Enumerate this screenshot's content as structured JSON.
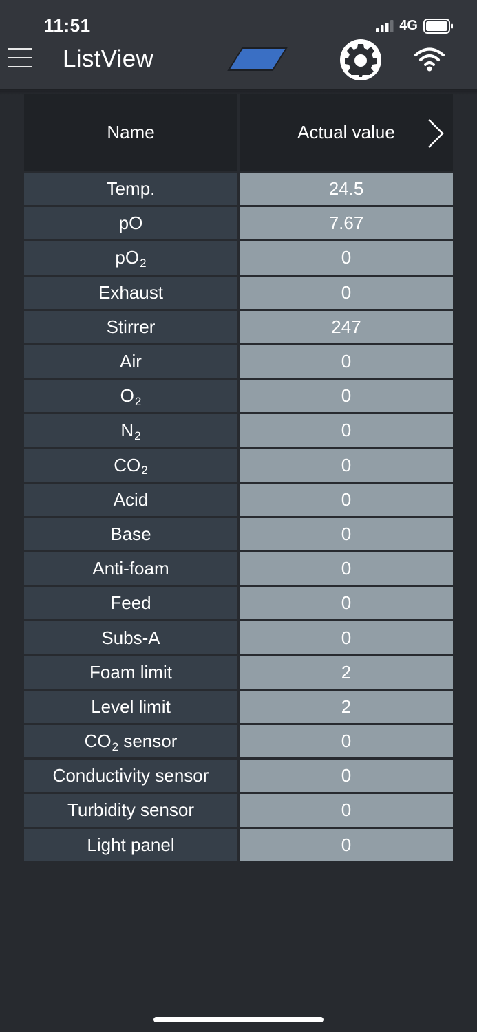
{
  "status_bar": {
    "time": "11:51",
    "network": "4G"
  },
  "app_bar": {
    "title": "ListView",
    "icons": [
      "menu-icon",
      "device-icon",
      "settings-icon",
      "wifi-icon"
    ],
    "device_icon_color": "#3a6fc4"
  },
  "table": {
    "header": {
      "name": "Name",
      "value": "Actual value"
    },
    "rows": [
      {
        "name": "Temp.",
        "sub": "",
        "suffix": "",
        "value": "24.5"
      },
      {
        "name": "pO",
        "sub": "",
        "suffix": "",
        "value": "7.67"
      },
      {
        "name": "pO",
        "sub": "2",
        "suffix": "",
        "value": "0"
      },
      {
        "name": "Exhaust",
        "sub": "",
        "suffix": "",
        "value": "0"
      },
      {
        "name": "Stirrer",
        "sub": "",
        "suffix": "",
        "value": "247"
      },
      {
        "name": "Air",
        "sub": "",
        "suffix": "",
        "value": "0"
      },
      {
        "name": "O",
        "sub": "2",
        "suffix": "",
        "value": "0"
      },
      {
        "name": "N",
        "sub": "2",
        "suffix": "",
        "value": "0"
      },
      {
        "name": "CO",
        "sub": "2",
        "suffix": "",
        "value": "0"
      },
      {
        "name": "Acid",
        "sub": "",
        "suffix": "",
        "value": "0"
      },
      {
        "name": "Base",
        "sub": "",
        "suffix": "",
        "value": "0"
      },
      {
        "name": "Anti-foam",
        "sub": "",
        "suffix": "",
        "value": "0"
      },
      {
        "name": "Feed",
        "sub": "",
        "suffix": "",
        "value": "0"
      },
      {
        "name": "Subs-A",
        "sub": "",
        "suffix": "",
        "value": "0"
      },
      {
        "name": "Foam limit",
        "sub": "",
        "suffix": "",
        "value": "2"
      },
      {
        "name": "Level limit",
        "sub": "",
        "suffix": "",
        "value": "2"
      },
      {
        "name": "CO",
        "sub": "2",
        "suffix": " sensor",
        "value": "0"
      },
      {
        "name": "Conductivity sensor",
        "sub": "",
        "suffix": "",
        "value": "0"
      },
      {
        "name": "Turbidity sensor",
        "sub": "",
        "suffix": "",
        "value": "0"
      },
      {
        "name": "Light panel",
        "sub": "",
        "suffix": "",
        "value": "0"
      }
    ]
  },
  "colors": {
    "background": "#272a2f",
    "app_bar": "#33363c",
    "header_cell": "#1f2226",
    "name_cell": "#363f49",
    "value_cell": "#929ea6"
  }
}
